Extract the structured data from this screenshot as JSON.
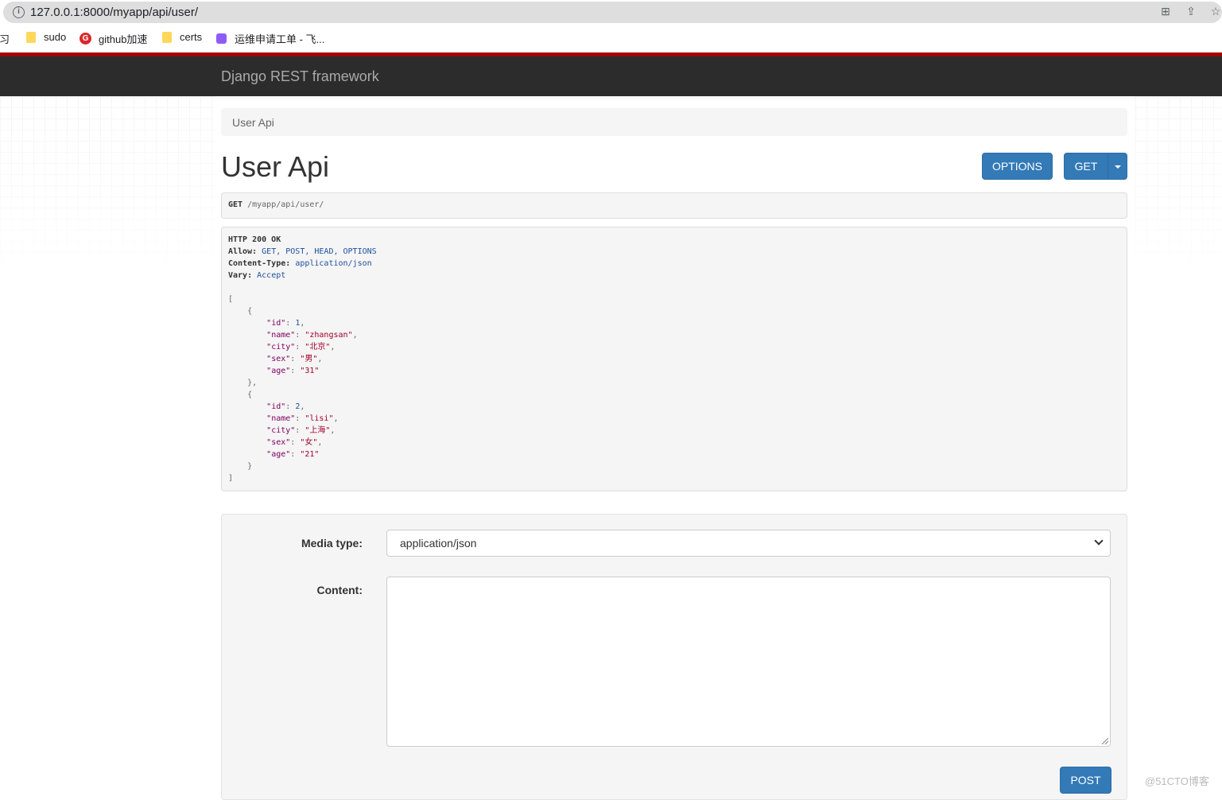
{
  "browser": {
    "url": "127.0.0.1:8000/myapp/api/user/",
    "bookmarks": [
      "学习",
      "sudo",
      "github加速",
      "certs",
      "运维申请工单 - 飞..."
    ]
  },
  "navbar": {
    "brand": "Django REST framework"
  },
  "breadcrumb": {
    "current": "User Api"
  },
  "page": {
    "title": "User Api",
    "options_label": "OPTIONS",
    "get_label": "GET"
  },
  "request": {
    "method": "GET",
    "path": "/myapp/api/user/"
  },
  "response": {
    "status": "HTTP 200 OK",
    "headers": [
      {
        "key": "Allow:",
        "value": "GET, POST, HEAD, OPTIONS"
      },
      {
        "key": "Content-Type:",
        "value": "application/json"
      },
      {
        "key": "Vary:",
        "value": "Accept"
      }
    ],
    "users": [
      {
        "id": "1",
        "name": "\"zhangsan\"",
        "city": "\"北京\"",
        "sex": "\"男\"",
        "age": "\"31\""
      },
      {
        "id": "2",
        "name": "\"lisi\"",
        "city": "\"上海\"",
        "sex": "\"女\"",
        "age": "\"21\""
      }
    ]
  },
  "form": {
    "media_type_label": "Media type:",
    "media_type_value": "application/json",
    "content_label": "Content:",
    "post_label": "POST"
  },
  "watermark": "@51CTO博客"
}
